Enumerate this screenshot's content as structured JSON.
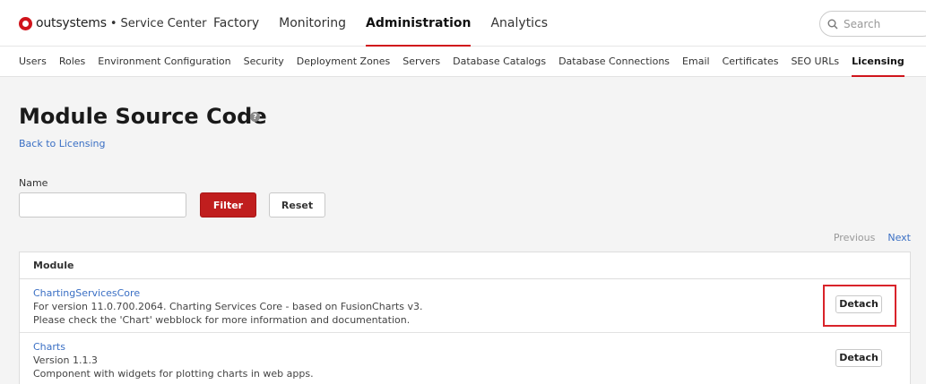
{
  "brand": {
    "name": "outsystems",
    "separator": "•",
    "product": "Service Center",
    "color": "#d0141b"
  },
  "main_nav": [
    {
      "label": "Factory"
    },
    {
      "label": "Monitoring"
    },
    {
      "label": "Administration",
      "active": true
    },
    {
      "label": "Analytics"
    }
  ],
  "search": {
    "placeholder": "Search",
    "icon": "search-icon"
  },
  "sub_nav": [
    {
      "label": "Users"
    },
    {
      "label": "Roles"
    },
    {
      "label": "Environment Configuration"
    },
    {
      "label": "Security"
    },
    {
      "label": "Deployment Zones"
    },
    {
      "label": "Servers"
    },
    {
      "label": "Database Catalogs"
    },
    {
      "label": "Database Connections"
    },
    {
      "label": "Email"
    },
    {
      "label": "Certificates"
    },
    {
      "label": "SEO URLs"
    },
    {
      "label": "Licensing",
      "active": true
    }
  ],
  "page": {
    "title": "Module Source Code",
    "help_icon": "?",
    "back_link": "Back to Licensing"
  },
  "filter": {
    "name_label": "Name",
    "name_value": "",
    "filter_label": "Filter",
    "reset_label": "Reset"
  },
  "pager": {
    "previous": "Previous",
    "next": "Next"
  },
  "table": {
    "header": "Module",
    "rows": [
      {
        "name": "ChartingServicesCore",
        "desc_line1": "For version 11.0.700.2064. Charting Services Core - based  on FusionCharts v3.",
        "desc_line2": "Please check the 'Chart' webblock for more information and documentation.",
        "action": "Detach"
      },
      {
        "name": "Charts",
        "desc_line1": "Version 1.1.3",
        "desc_line2": "Component with widgets for plotting charts in web apps.",
        "action": "Detach"
      }
    ]
  },
  "colors": {
    "accent": "#d0141b",
    "link": "#3a6fc4",
    "filter_button": "#c01e1e",
    "highlight": "#d9232a"
  }
}
